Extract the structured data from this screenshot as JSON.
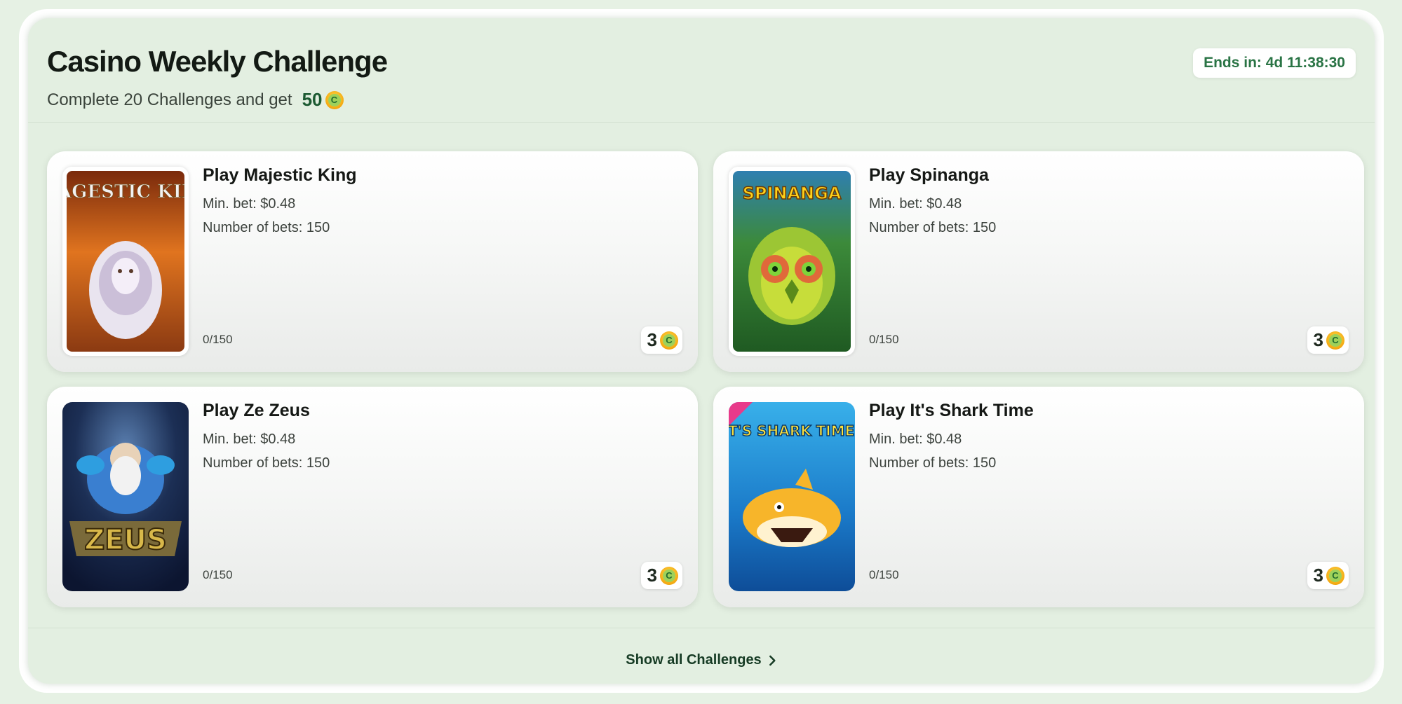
{
  "header": {
    "title": "Casino Weekly Challenge",
    "subtitle": "Complete 20 Challenges and get",
    "reward_amount": "50",
    "timer": "Ends in: 4d 11:38:30"
  },
  "coin_symbol": "C",
  "challenges": [
    {
      "title": "Play Majestic King",
      "min_bet": "Min. bet: $0.48",
      "num_bets": "Number of bets: 150",
      "progress": "0/150",
      "reward": "3",
      "game_art": "MAGESTIC KING"
    },
    {
      "title": "Play Spinanga",
      "min_bet": "Min. bet: $0.48",
      "num_bets": "Number of bets: 150",
      "progress": "0/150",
      "reward": "3",
      "game_art": "SPINANGA"
    },
    {
      "title": "Play Ze Zeus",
      "min_bet": "Min. bet: $0.48",
      "num_bets": "Number of bets: 150",
      "progress": "0/150",
      "reward": "3",
      "game_art": "ZEUS"
    },
    {
      "title": "Play It's Shark Time",
      "min_bet": "Min. bet: $0.48",
      "num_bets": "Number of bets: 150",
      "progress": "0/150",
      "reward": "3",
      "game_art": "IT'S SHARK TIME!"
    }
  ],
  "footer": {
    "show_all_label": "Show all Challenges"
  },
  "colors": {
    "panel_bg": "#e3efe1",
    "accent_green": "#2a7445",
    "coin_gold": "#f3a911"
  }
}
